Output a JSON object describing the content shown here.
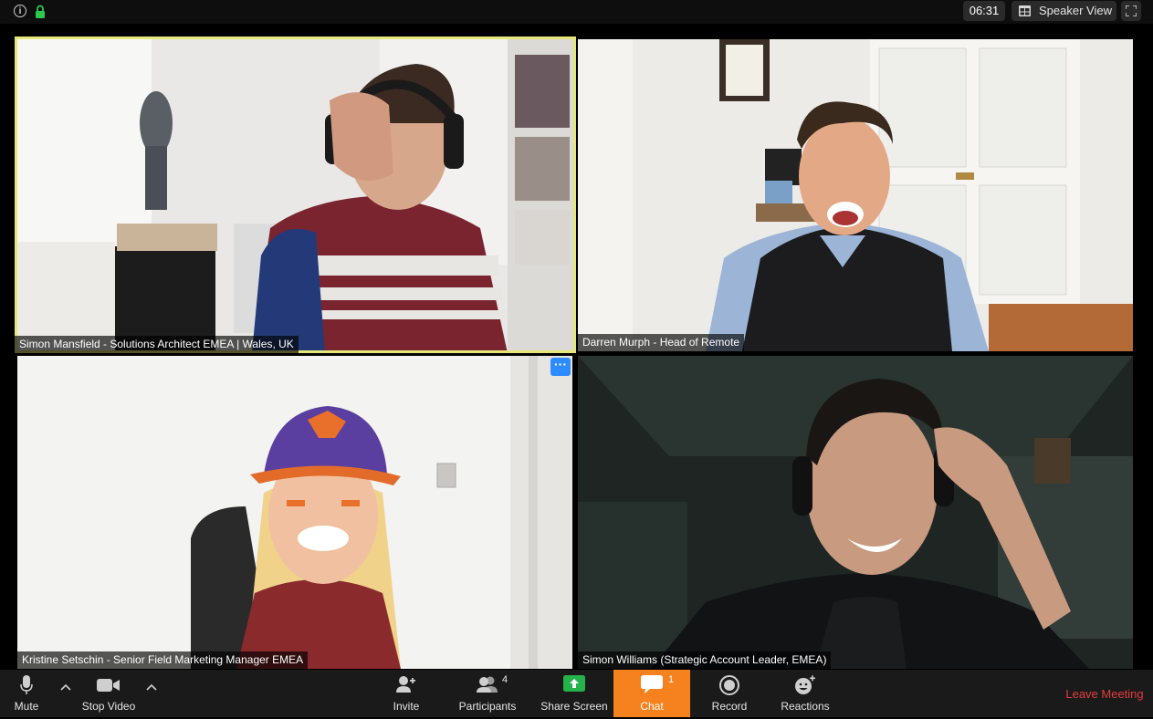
{
  "window": {
    "timer": "06:31",
    "view_label": "Speaker View"
  },
  "participants": [
    {
      "name": "Simon Mansfield - Solutions Architect EMEA | Wales, UK",
      "active_speaker": true
    },
    {
      "name": "Darren Murph - Head of Remote",
      "active_speaker": false
    },
    {
      "name": "Kristine Setschin - Senior Field Marketing Manager EMEA",
      "active_speaker": false
    },
    {
      "name": "Simon Williams (Strategic Account Leader, EMEA)",
      "active_speaker": false
    }
  ],
  "toolbar": {
    "mute_label": "Mute",
    "stop_video_label": "Stop Video",
    "invite_label": "Invite",
    "participants_label": "Participants",
    "participants_count": "4",
    "share_screen_label": "Share Screen",
    "chat_label": "Chat",
    "chat_unread": "1",
    "record_label": "Record",
    "reactions_label": "Reactions",
    "leave_label": "Leave Meeting"
  },
  "colors": {
    "active_speaker_border": "#e6e77a",
    "chat_highlight": "#f6821f",
    "share_screen_green": "#24b24a",
    "leave_red": "#e63c3c",
    "more_button_blue": "#2d8cff"
  }
}
